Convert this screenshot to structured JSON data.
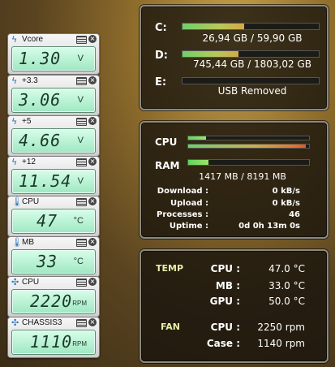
{
  "gadgets": [
    {
      "label": "Vcore",
      "icon": "bolt-icon",
      "value": "1.30",
      "unit": "V"
    },
    {
      "label": "+3.3",
      "icon": "bolt-icon",
      "value": "3.06",
      "unit": "V"
    },
    {
      "label": "+5",
      "icon": "bolt-icon",
      "value": "4.66",
      "unit": "V"
    },
    {
      "label": "+12",
      "icon": "bolt-icon",
      "value": "11.54",
      "unit": "V"
    },
    {
      "label": "CPU",
      "icon": "thermometer-icon",
      "value": "47",
      "unit": "°C"
    },
    {
      "label": "MB",
      "icon": "thermometer-icon",
      "value": "33",
      "unit": "°C"
    },
    {
      "label": "CPU",
      "icon": "fan-icon",
      "value": "2220",
      "unit": "RPM"
    },
    {
      "label": "CHASSIS3",
      "icon": "fan-icon",
      "value": "1110",
      "unit": "RPM"
    }
  ],
  "drives": [
    {
      "letter": "C:",
      "text": "26,94 GB / 59,90 GB",
      "usage": 0.45
    },
    {
      "letter": "D:",
      "text": "745,44 GB / 1803,02 GB",
      "usage": 0.41
    },
    {
      "letter": "E:",
      "text": "USB Removed",
      "usage": 0
    }
  ],
  "system": {
    "cpu_label": "CPU",
    "cpu_usage": [
      0.15,
      0.97
    ],
    "ram_label": "RAM",
    "ram_usage": 0.17,
    "ram_text": "1417 MB / 8191 MB",
    "rows": [
      {
        "key": "Download :",
        "value": "0 kB/s"
      },
      {
        "key": "Upload :",
        "value": "0 kB/s"
      },
      {
        "key": "Processes :",
        "value": "46"
      },
      {
        "key": "Uptime :",
        "value": "0d 0h 13m 0s"
      }
    ]
  },
  "temps": {
    "temp_label": "TEMP",
    "temp_rows": [
      {
        "key": "CPU :",
        "value": "47.0 °C"
      },
      {
        "key": "MB :",
        "value": "33.0 °C"
      },
      {
        "key": "GPU :",
        "value": "50.0 °C"
      }
    ],
    "fan_label": "FAN",
    "fan_rows": [
      {
        "key": "CPU :",
        "value": "2250 rpm"
      },
      {
        "key": "Case :",
        "value": "1140 rpm"
      }
    ]
  }
}
